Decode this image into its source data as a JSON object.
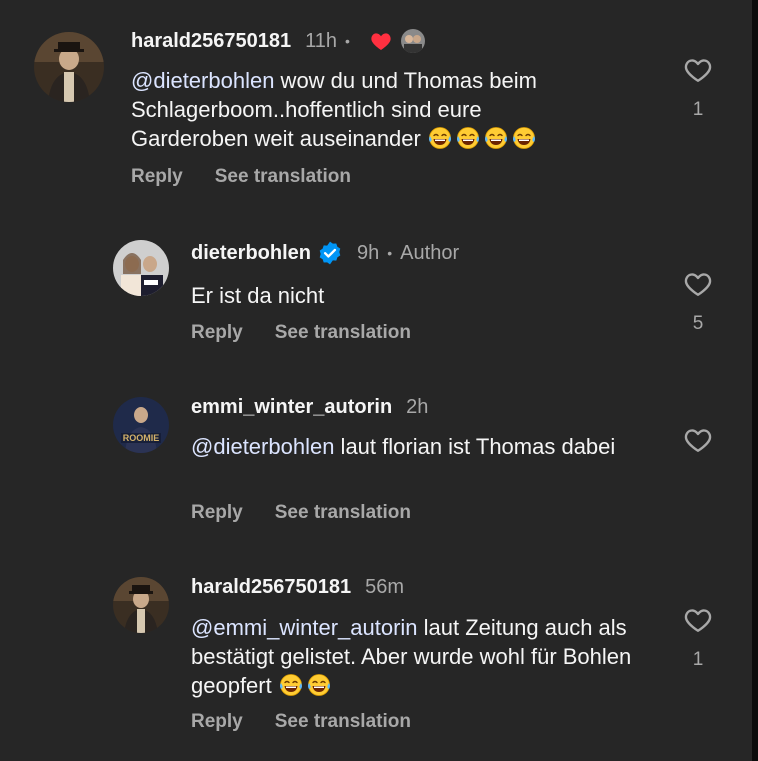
{
  "comments": [
    {
      "username": "harald256750181",
      "time": "11h",
      "separator": "•",
      "mention": "@dieterbohlen",
      "text": " wow du und Thomas beim Schlagerboom..hoffentlich sind eure Garderoben weit auseinander",
      "emoji_count": 4,
      "reply_label": "Reply",
      "translate_label": "See translation",
      "like_count": "1",
      "liked_by_author_icon": "red-heart-icon"
    },
    {
      "username": "dieterbohlen",
      "verified": true,
      "time": "9h",
      "separator": "•",
      "author_label": "Author",
      "text": "Er ist da nicht",
      "reply_label": "Reply",
      "translate_label": "See translation",
      "like_count": "5"
    },
    {
      "username": "emmi_winter_autorin",
      "time": "2h",
      "mention": "@dieterbohlen",
      "text": " laut florian ist Thomas dabei",
      "reply_label": "Reply",
      "translate_label": "See translation",
      "like_count": ""
    },
    {
      "username": "harald256750181",
      "time": "56m",
      "mention": "@emmi_winter_autorin",
      "text": " laut Zeitung auch als bestätigt gelistet. Aber wurde wohl für Bohlen geopfert",
      "emoji_count": 2,
      "reply_label": "Reply",
      "translate_label": "See translation",
      "like_count": "1"
    }
  ],
  "colors": {
    "background": "#262626",
    "primary_text": "#f5f5f5",
    "secondary_text": "#a8a8a8",
    "verified_blue": "#0095f6",
    "like_red": "#ff3040"
  }
}
